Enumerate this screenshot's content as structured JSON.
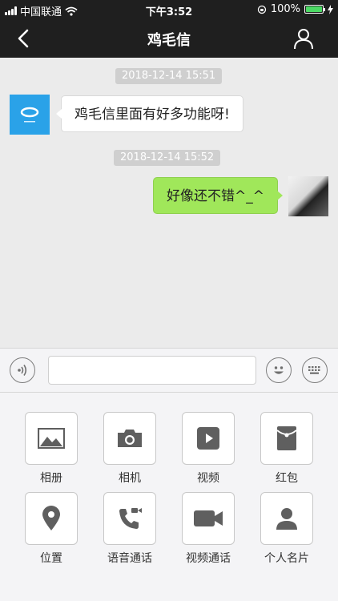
{
  "status_bar": {
    "carrier": "中国联通",
    "time": "下午3:52",
    "battery": "100%",
    "battery_level": 1.0
  },
  "nav": {
    "title": "鸡毛信"
  },
  "messages": [
    {
      "timestamp": "2018-12-14 15:51",
      "text": "鸡毛信里面有好多功能呀!",
      "side": "left"
    },
    {
      "timestamp": "2018-12-14 15:52",
      "text": "好像还不错^_^",
      "side": "right"
    }
  ],
  "input": {
    "value": "",
    "placeholder": ""
  },
  "tools": [
    {
      "label": "相册",
      "icon": "photo-album-icon"
    },
    {
      "label": "相机",
      "icon": "camera-icon"
    },
    {
      "label": "视频",
      "icon": "video-play-icon"
    },
    {
      "label": "红包",
      "icon": "red-envelope-icon"
    },
    {
      "label": "位置",
      "icon": "location-pin-icon"
    },
    {
      "label": "语音通话",
      "icon": "phone-call-icon"
    },
    {
      "label": "视频通话",
      "icon": "video-camera-icon"
    },
    {
      "label": "个人名片",
      "icon": "person-card-icon"
    }
  ],
  "colors": {
    "dark_bar": "#1f1f1f",
    "sent_bubble": "#a0e75a",
    "chat_bg": "#ebebeb",
    "icon_gray": "#5f5f5f"
  }
}
